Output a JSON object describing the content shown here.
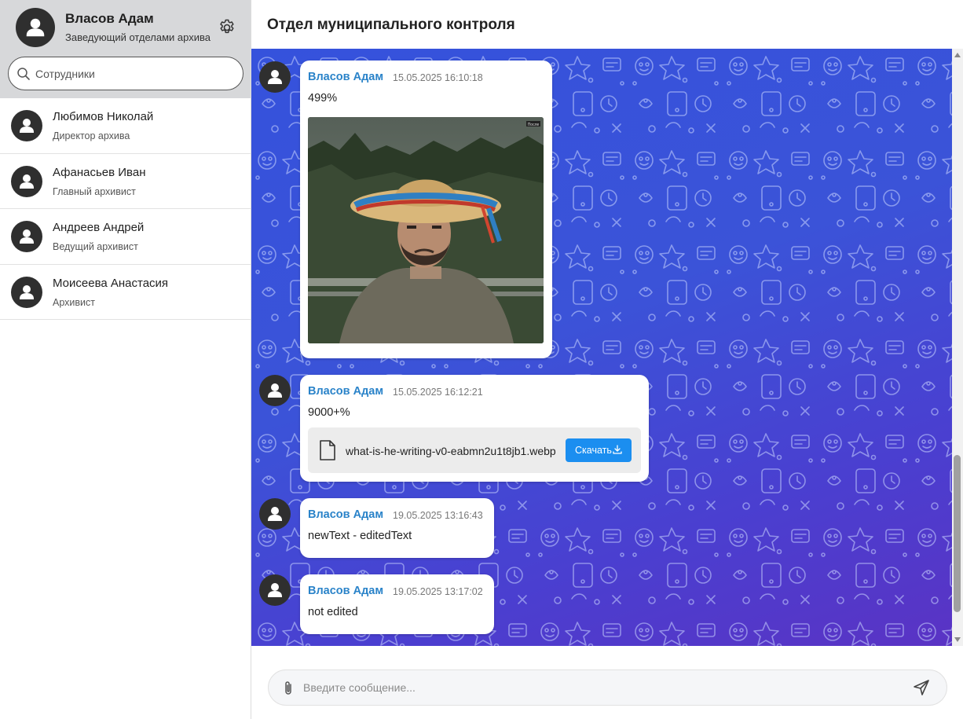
{
  "profile": {
    "name": "Власов Адам",
    "role": "Заведующий отделами архива",
    "avatar_icon": "user-icon",
    "settings_icon": "gear-icon"
  },
  "search": {
    "placeholder": "Сотрудники",
    "icon": "search-icon"
  },
  "contacts": [
    {
      "name": "Любимов Николай",
      "role": "Директор архива"
    },
    {
      "name": "Афанасьев Иван",
      "role": "Главный архивист"
    },
    {
      "name": "Андреев Андрей",
      "role": "Ведущий архивист"
    },
    {
      "name": "Моисеева Анастасия",
      "role": "Архивист"
    }
  ],
  "chat": {
    "title": "Отдел муниципального контроля",
    "messages": [
      {
        "author": "Власов Адам",
        "time": "15.05.2025 16:10:18",
        "text": "499%",
        "attachment": "image",
        "image_badge": "После"
      },
      {
        "author": "Власов Адам",
        "time": "15.05.2025 16:12:21",
        "text": "9000+%",
        "attachment": "file",
        "file_name": "what-is-he-writing-v0-eabmn2u1t8jb1.webp",
        "download_label": "Скачать"
      },
      {
        "author": "Власов Адам",
        "time": "19.05.2025 13:16:43",
        "text": "newText - editedText"
      },
      {
        "author": "Власов Адам",
        "time": "19.05.2025 13:17:02",
        "text": "not edited"
      }
    ]
  },
  "composer": {
    "placeholder": "Введите сообщение...",
    "attach_icon": "paperclip-icon",
    "send_icon": "send-icon"
  },
  "colors": {
    "accent": "#1b8ef0",
    "author": "#2a83c9",
    "chat_bg_start": "#3552dc",
    "chat_bg_end": "#5a33c4",
    "sidebar_header": "#d7d8da"
  }
}
